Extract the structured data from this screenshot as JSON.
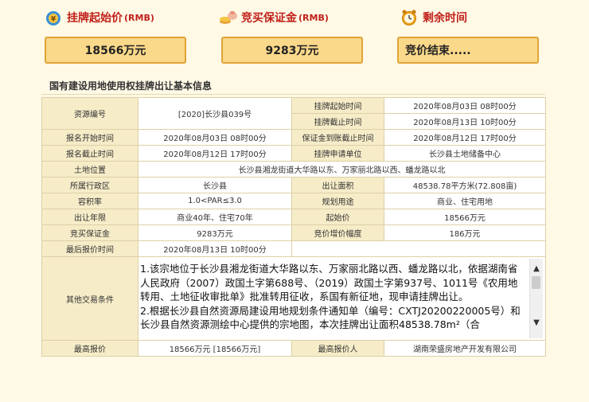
{
  "header": {
    "start_price_label": "挂牌起始价",
    "start_price_unit": "(RMB)",
    "deposit_label": "竞买保证金",
    "deposit_unit": "(RMB)",
    "remaining_label": "剩余时间"
  },
  "summary": {
    "start_price": "18566万元",
    "deposit": "9283万元",
    "remaining": "竞价结束....."
  },
  "section_title": "国有建设用地使用权挂牌出让基本信息",
  "table": {
    "resource_no_label": "资源编号",
    "resource_no": "[2020]长沙县039号",
    "listing_start_label": "挂牌起始时间",
    "listing_start": "2020年08月03日 08时00分",
    "listing_end_label": "挂牌截止时间",
    "listing_end": "2020年08月13日 10时00分",
    "apply_start_label": "报名开始时间",
    "apply_start": "2020年08月03日 08时00分",
    "deposit_deadline_label": "保证金到账截止时间",
    "deposit_deadline": "2020年08月12日 17时00分",
    "apply_end_label": "报名截止时间",
    "apply_end": "2020年08月12日 17时00分",
    "applicant_unit_label": "挂牌申请单位",
    "applicant_unit": "长沙县土地储备中心",
    "location_label": "土地位置",
    "location": "长沙县湘龙街道大华路以东、万家丽北路以西、蟠龙路以北",
    "district_label": "所属行政区",
    "district": "长沙县",
    "area_label": "出让面积",
    "area": "48538.78平方米(72.808亩)",
    "far_label": "容积率",
    "far": "1.0<PAR≤3.0",
    "use_label": "规划用途",
    "use": "商业、住宅用地",
    "years_label": "出让年限",
    "years": "商业40年、住宅70年",
    "start_price_label": "起始价",
    "start_price": "18566万元",
    "deposit_label": "竞买保证金",
    "deposit": "9283万元",
    "increment_label": "竞价增价幅度",
    "increment": "186万元",
    "last_quote_label": "最后报价时间",
    "last_quote": "2020年08月13日 10时00分",
    "other_label": "其他交易条件",
    "other_p1": "1.该宗地位于长沙县湘龙街道大华路以东、万家丽北路以西、蟠龙路以北，依据湖南省人民政府（2007）政国土字第688号、（2019）政国土字第937号、1011号《农用地转用、土地征收审批单》批准转用征收，系国有新征地，现申请挂牌出让。",
    "other_p2": "2.根据长沙县自然资源局建设用地规划条件通知单（编号：CXTJ20200220005号）和长沙县自然资源测绘中心提供的宗地图，本次挂牌出让面积48538.78m²（合",
    "top_price_label": "最高报价",
    "top_price": "18566万元 [18566万元]",
    "top_bidder_label": "最高报价人",
    "top_bidder": "湖南荣盛房地产开发有限公司"
  },
  "colors": {
    "accent_red": "#c0211a",
    "box_fill": "#fbd98a",
    "box_border": "#e1a437",
    "background": "#fff9e6"
  }
}
